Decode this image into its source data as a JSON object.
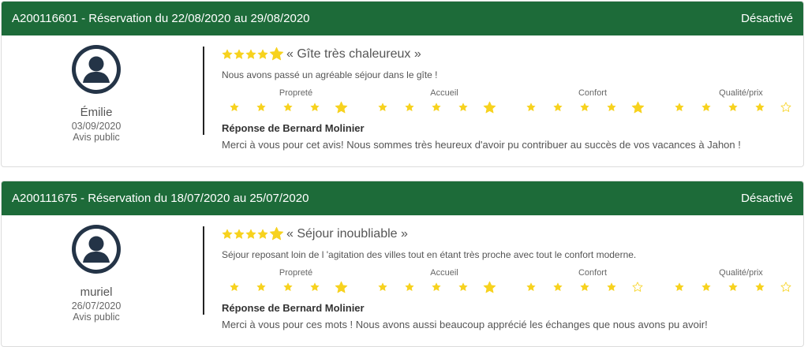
{
  "colors": {
    "header_bg": "#1d6b39",
    "star": "#f7d21e",
    "star_empty": "#f7d21e"
  },
  "criteria_labels": [
    "Propreté",
    "Accueil",
    "Confort",
    "Qualité/prix"
  ],
  "reviews": [
    {
      "header": "A200116601 - Réservation du 22/08/2020 au 29/08/2020",
      "status": "Désactivé",
      "user_name": "Émilie",
      "date": "03/09/2020",
      "visibility": "Avis public",
      "overall_rating": 5,
      "title": "« Gîte très chaleureux »",
      "comment": "Nous avons passé un agréable séjour dans le gîte !",
      "ratings": [
        5,
        5,
        5,
        4
      ],
      "response_title": "Réponse de Bernard Molinier",
      "response_text": "Merci à vous pour cet avis! Nous sommes très heureux d'avoir pu contribuer au succès de vos vacances à Jahon !"
    },
    {
      "header": "A200111675 - Réservation du 18/07/2020 au 25/07/2020",
      "status": "Désactivé",
      "user_name": "muriel",
      "date": "26/07/2020",
      "visibility": "Avis public",
      "overall_rating": 5,
      "title": "« Séjour inoubliable »",
      "comment": "Séjour reposant loin de l 'agitation des villes tout en étant très proche avec tout le confort moderne.",
      "ratings": [
        5,
        5,
        4,
        4
      ],
      "response_title": "Réponse de Bernard Molinier",
      "response_text": "Merci à vous pour ces mots ! Nous avons aussi beaucoup apprécié les échanges que nous avons pu avoir!"
    }
  ]
}
